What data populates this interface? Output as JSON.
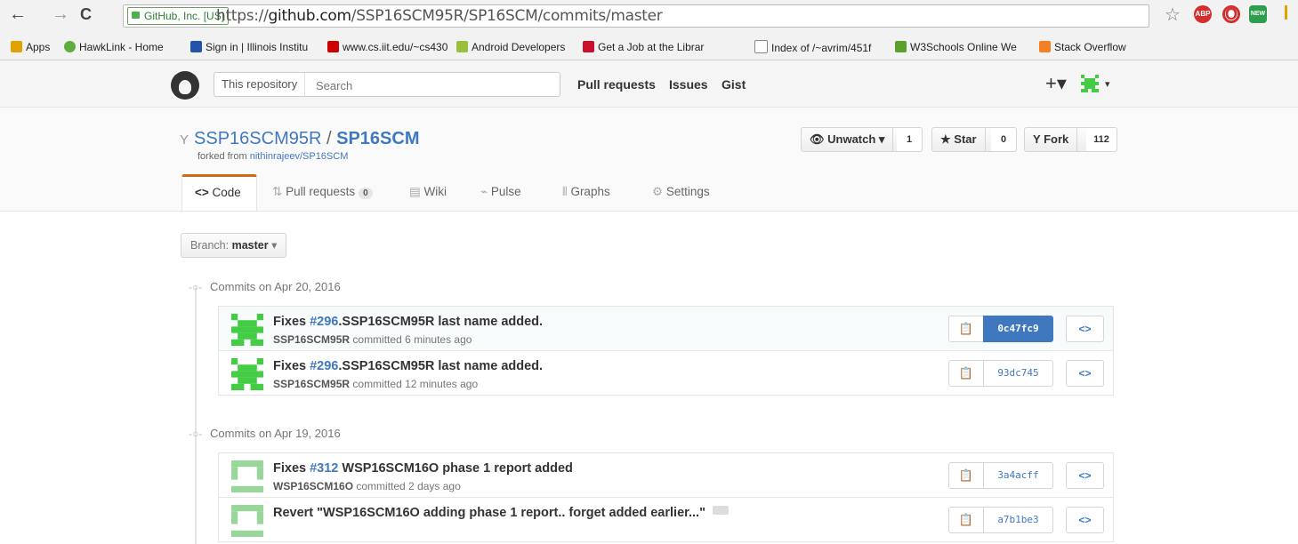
{
  "browser": {
    "secure_label": "GitHub, Inc. [US]",
    "url_prefix": "https://",
    "url_host": "github.com",
    "url_path": "/SSP16SCM95R/SP16SCM/commits/master",
    "bookmarks": [
      {
        "label": "Apps",
        "color": "#e0a200"
      },
      {
        "label": "HawkLink - Home",
        "color": "#5cae3c"
      },
      {
        "label": "Sign in | Illinois Institu",
        "color": "#2255aa"
      },
      {
        "label": "www.cs.iit.edu/~cs430",
        "color": "#cc0000"
      },
      {
        "label": "Android Developers",
        "color": "#97c03d"
      },
      {
        "label": "Get a Job at the Librar",
        "color": "#c8102e"
      },
      {
        "label": "Index of /~avrim/451f",
        "color": "#888888"
      },
      {
        "label": "W3Schools Online We",
        "color": "#5aa02c"
      },
      {
        "label": "Stack Overflow",
        "color": "#f48024"
      }
    ],
    "extensions": [
      {
        "name": "star-icon",
        "label": "☆"
      },
      {
        "name": "adblock-icon",
        "label": "ABP"
      },
      {
        "name": "opera-icon",
        "label": "O"
      },
      {
        "name": "new-extension-icon",
        "label": "NEW"
      }
    ]
  },
  "header": {
    "search_scope": "This repository",
    "search_placeholder": "Search",
    "nav": [
      "Pull requests",
      "Issues",
      "Gist"
    ],
    "plus": "+▾"
  },
  "repo": {
    "owner": "SSP16SCM95R",
    "separator": "/",
    "name": "SP16SCM",
    "forked_prefix": "forked from",
    "forked_from": "nithinrajeev/SP16SCM",
    "unwatch_label": "Unwatch ▾",
    "unwatch_count": "1",
    "star_label": "Star",
    "star_count": "0",
    "fork_label": "Fork",
    "fork_count": "112",
    "tabs": {
      "code": "Code",
      "pull_requests": "Pull requests",
      "pull_requests_count": "0",
      "wiki": "Wiki",
      "pulse": "Pulse",
      "graphs": "Graphs",
      "settings": "Settings"
    }
  },
  "branch": {
    "prefix": "Branch:",
    "name": "master",
    "caret": "▾"
  },
  "commit_groups": [
    {
      "date_label": "Commits on Apr 20, 2016",
      "commits": [
        {
          "prefix": "Fixes ",
          "issue": "#296",
          "rest": ".SSP16SCM95R last name added.",
          "author": "SSP16SCM95R",
          "time": "committed 6 minutes ago",
          "sha": "0c47fc9",
          "avatar_color": "#44cc44"
        },
        {
          "prefix": "Fixes ",
          "issue": "#296",
          "rest": ".SSP16SCM95R last name added.",
          "author": "SSP16SCM95R",
          "time": "committed 12 minutes ago",
          "sha": "93dc745",
          "avatar_color": "#44cc44"
        }
      ]
    },
    {
      "date_label": "Commits on Apr 19, 2016",
      "commits": [
        {
          "prefix": "Fixes ",
          "issue": "#312",
          "rest": " WSP16SCM16O phase 1 report added",
          "author": "WSP16SCM16O",
          "time": "committed 2 days ago",
          "sha": "3a4acff",
          "avatar_color": "#99d699"
        },
        {
          "prefix": "",
          "issue": "",
          "rest": "Revert \"WSP16SCM16O adding phase 1 report.. forget added earlier...\"",
          "author": "",
          "time": "",
          "sha": "a7b1be3",
          "avatar_color": "#99d699"
        }
      ]
    }
  ]
}
